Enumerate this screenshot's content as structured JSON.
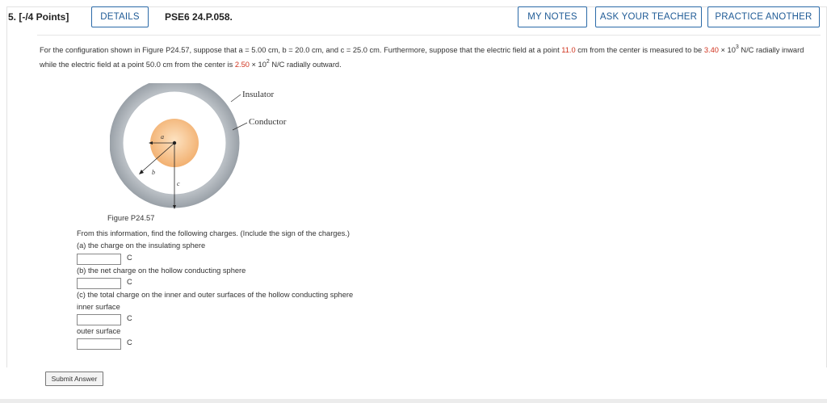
{
  "header": {
    "question_number": "5.  [-/4 Points]",
    "details_label": "DETAILS",
    "problem_id": "PSE6 24.P.058.",
    "my_notes_label": "MY NOTES",
    "ask_teacher_label": "ASK YOUR TEACHER",
    "practice_label": "PRACTICE ANOTHER"
  },
  "problem": {
    "text_part1": "For the configuration shown in Figure P24.57, suppose that a = 5.00 cm, b = 20.0 cm, and c = 25.0 cm. Furthermore, suppose that the electric field at a point ",
    "distance_value": "11.0",
    "text_part2": " cm from the center is measured to be ",
    "field1_value": "3.40",
    "field1_mult": " × 10",
    "field1_exp": "3",
    "text_part3": " N/C radially inward while the electric field at a point 50.0 cm from the center is ",
    "field2_value": "2.50",
    "field2_mult": " × 10",
    "field2_exp": "2",
    "text_part4": " N/C radially outward."
  },
  "figure": {
    "insulator_label": "Insulator",
    "conductor_label": "Conductor",
    "a_label": "a",
    "b_label": "b",
    "c_label": "c",
    "caption": "Figure P24.57"
  },
  "questions": {
    "instruction": "From this information, find the following charges. (Include the sign of the charges.)",
    "a_label": "(a) the charge on the insulating sphere",
    "b_label": "(b) the net charge on the hollow conducting sphere",
    "c_label": "(c) the total charge on the inner and outer surfaces of the hollow conducting sphere",
    "inner_label": "inner surface",
    "outer_label": "outer surface",
    "unit": "C",
    "answer_a": "",
    "answer_b": "",
    "answer_inner": "",
    "answer_outer": ""
  },
  "submit_label": "Submit Answer",
  "colors": {
    "accent_blue": "#2b6aa8",
    "value_red": "#d0341f",
    "insulator_orange": "#f6c089",
    "conductor_gray": "#aeb4bb"
  }
}
